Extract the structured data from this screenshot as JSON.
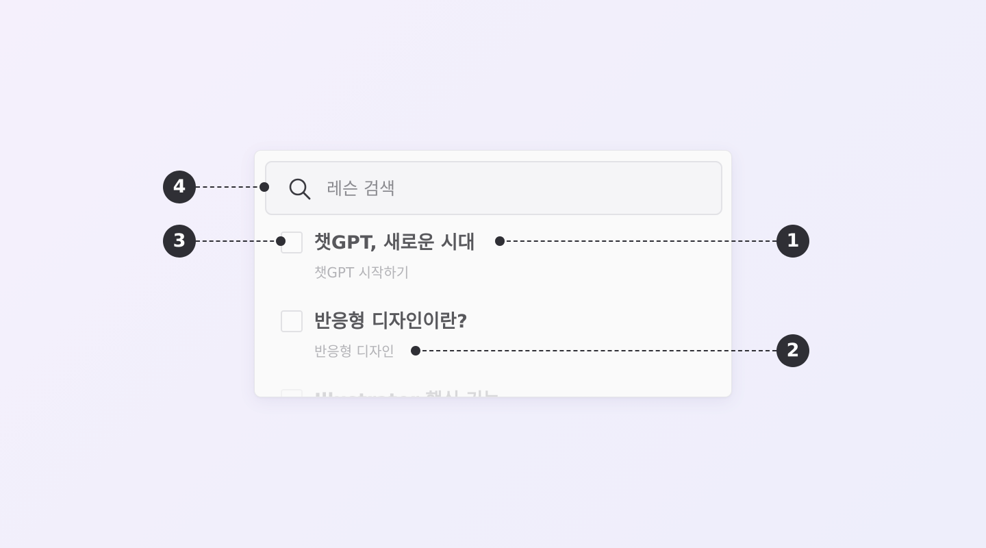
{
  "search": {
    "placeholder": "레슨 검색",
    "icon": "search-icon"
  },
  "lessons": [
    {
      "title": "챗GPT, 새로운 시대",
      "subtitle": "챗GPT 시작하기",
      "checked": false
    },
    {
      "title": "반응형 디자인이란?",
      "subtitle": "반응형 디자인",
      "checked": false
    },
    {
      "title": "Illustrator 핵심 기능",
      "subtitle": "",
      "checked": false
    }
  ],
  "callouts": [
    {
      "number": "1"
    },
    {
      "number": "2"
    },
    {
      "number": "3"
    },
    {
      "number": "4"
    }
  ],
  "colors": {
    "background": "#f1effb",
    "panel": "#fafafa",
    "callout": "#2f2f35"
  }
}
